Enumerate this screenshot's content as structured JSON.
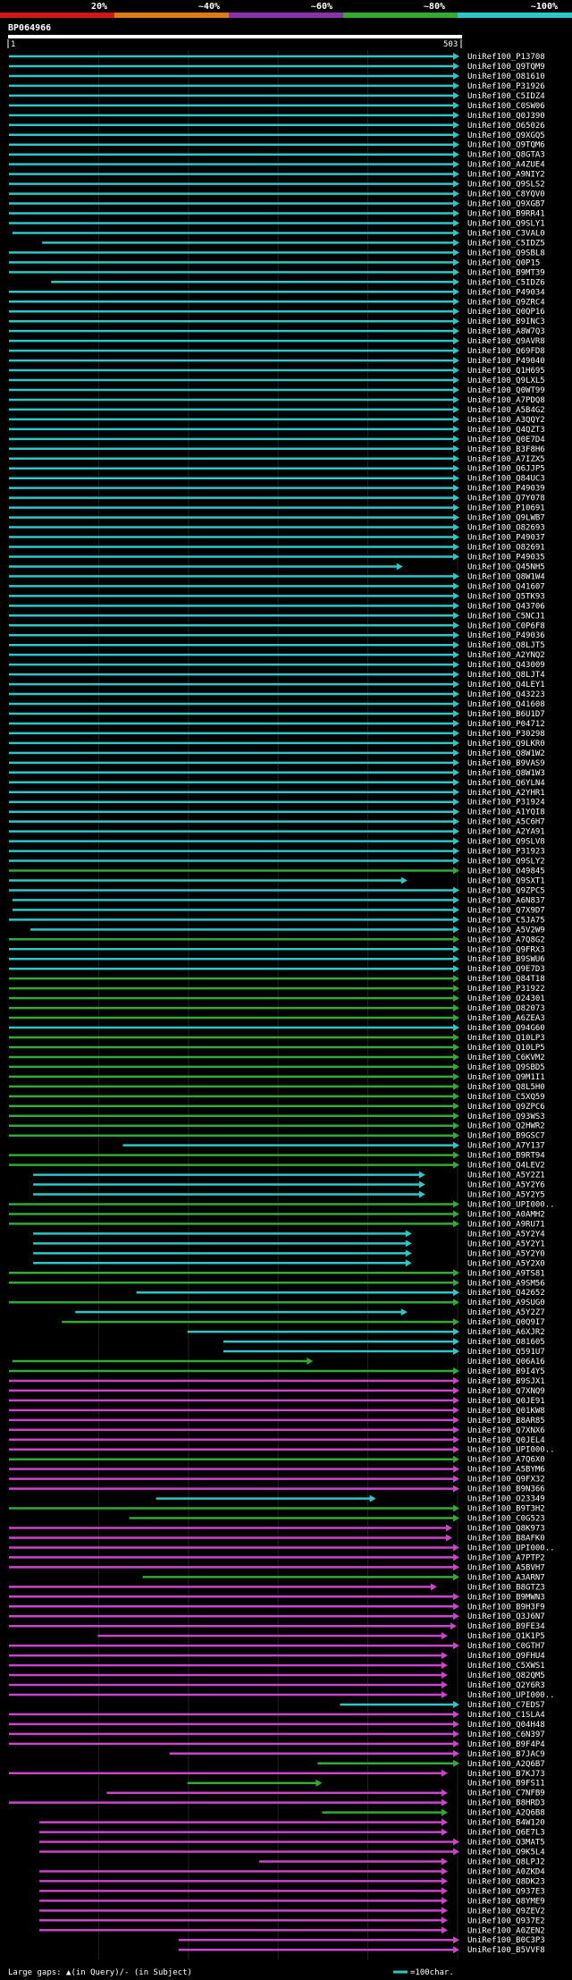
{
  "title": "BP064966",
  "colors": {
    "cyan": "#2cc8c8",
    "green": "#33aa33",
    "magenta": "#cc44cc",
    "purple": "#8833aa",
    "orange": "#e07a10",
    "red": "#d01818",
    "ruler": "#ffffff",
    "marker": "#e8e890"
  },
  "identity_scale": [
    {
      "label": "20%",
      "color": "#d01818"
    },
    {
      "label": "~40%",
      "color": "#e07a10"
    },
    {
      "label": "~60%",
      "color": "#8833aa"
    },
    {
      "label": "~80%",
      "color": "#33aa33"
    },
    {
      "label": "~100%",
      "color": "#2cc8c8"
    }
  ],
  "ruler": {
    "start_label": "1",
    "end_label": "503"
  },
  "legend": {
    "large_gaps_text": "Large gaps: ▲(in Query)/- (in Subject)",
    "scale_text": "=100char."
  },
  "chart_data": {
    "type": "alignment",
    "title": "BP064966",
    "query_length": 503,
    "xlim": [
      1,
      503
    ],
    "hits": [
      [
        "UniRef100_P13708",
        "c",
        1,
        503
      ],
      [
        "UniRef100_Q9TQM9",
        "c",
        1,
        503
      ],
      [
        "UniRef100_O81610",
        "c",
        1,
        503
      ],
      [
        "UniRef100_P31926",
        "c",
        1,
        503
      ],
      [
        "UniRef100_C5IDZ4",
        "c",
        1,
        503
      ],
      [
        "UniRef100_C0SW06",
        "c",
        1,
        503
      ],
      [
        "UniRef100_Q0J390",
        "c",
        1,
        503
      ],
      [
        "UniRef100_O65026",
        "c",
        1,
        503
      ],
      [
        "UniRef100_Q9XGQ5",
        "c",
        1,
        503
      ],
      [
        "UniRef100_Q9TQM6",
        "c",
        1,
        503
      ],
      [
        "UniRef100_Q8GTA3",
        "c",
        1,
        503
      ],
      [
        "UniRef100_A4ZUE4",
        "c",
        1,
        503
      ],
      [
        "UniRef100_A9NIY2",
        "c",
        1,
        503
      ],
      [
        "UniRef100_Q9SLS2",
        "c",
        1,
        503
      ],
      [
        "UniRef100_C8YQV0",
        "c",
        1,
        503
      ],
      [
        "UniRef100_Q9XGB7",
        "c",
        1,
        503
      ],
      [
        "UniRef100_B9RR41",
        "c",
        1,
        503
      ],
      [
        "UniRef100_Q9SLY1",
        "c",
        1,
        503
      ],
      [
        "UniRef100_C3VAL0",
        "c",
        5,
        503
      ],
      [
        "UniRef100_C5IDZ5",
        "c",
        38,
        503
      ],
      [
        "UniRef100_Q9SBL8",
        "c",
        1,
        503
      ],
      [
        "UniRef100_Q0P15",
        "c",
        1,
        503
      ],
      [
        "UniRef100_B9MT39",
        "c",
        1,
        503
      ],
      [
        "UniRef100_C5IDZ6",
        "c",
        48,
        503
      ],
      [
        "UniRef100_P49034",
        "c",
        1,
        503
      ],
      [
        "UniRef100_Q9ZRC4",
        "c",
        1,
        503
      ],
      [
        "UniRef100_Q0QP16",
        "c",
        1,
        503
      ],
      [
        "UniRef100_B9INC3",
        "c",
        1,
        503
      ],
      [
        "UniRef100_A8W7Q3",
        "c",
        1,
        503
      ],
      [
        "UniRef100_Q9AVR8",
        "c",
        1,
        503
      ],
      [
        "UniRef100_Q69FD8",
        "c",
        1,
        503
      ],
      [
        "UniRef100_P49040",
        "c",
        1,
        503
      ],
      [
        "UniRef100_Q1H695",
        "c",
        1,
        503
      ],
      [
        "UniRef100_Q9LXL5",
        "c",
        1,
        503
      ],
      [
        "UniRef100_Q0WT99",
        "c",
        1,
        503
      ],
      [
        "UniRef100_A7PDQ8",
        "c",
        1,
        503
      ],
      [
        "UniRef100_A5B4G2",
        "c",
        1,
        503
      ],
      [
        "UniRef100_A3QQY2",
        "c",
        1,
        503
      ],
      [
        "UniRef100_Q4QZT3",
        "c",
        1,
        503
      ],
      [
        "UniRef100_Q0E7D4",
        "c",
        1,
        503
      ],
      [
        "UniRef100_B3F8H6",
        "c",
        1,
        503
      ],
      [
        "UniRef100_A7IZX5",
        "c",
        1,
        503
      ],
      [
        "UniRef100_Q6JJP5",
        "c",
        1,
        503
      ],
      [
        "UniRef100_Q84UC3",
        "c",
        1,
        503
      ],
      [
        "UniRef100_P49039",
        "c",
        1,
        503
      ],
      [
        "UniRef100_Q7Y078",
        "c",
        1,
        503
      ],
      [
        "UniRef100_P10691",
        "c",
        1,
        503
      ],
      [
        "UniRef100_Q9LWB7",
        "c",
        1,
        503
      ],
      [
        "UniRef100_O82693",
        "c",
        1,
        503
      ],
      [
        "UniRef100_P49037",
        "c",
        1,
        503
      ],
      [
        "UniRef100_O82691",
        "c",
        1,
        503
      ],
      [
        "UniRef100_P49035",
        "c",
        1,
        503
      ],
      [
        "UniRef100_Q45NH5",
        "c",
        1,
        440
      ],
      [
        "UniRef100_Q8W1W4",
        "c",
        1,
        503
      ],
      [
        "UniRef100_Q41607",
        "c",
        1,
        503
      ],
      [
        "UniRef100_Q5TK93",
        "c",
        1,
        503
      ],
      [
        "UniRef100_Q43706",
        "c",
        1,
        503
      ],
      [
        "UniRef100_C5NCJ1",
        "c",
        1,
        503
      ],
      [
        "UniRef100_C0P6F8",
        "c",
        1,
        503
      ],
      [
        "UniRef100_P49036",
        "c",
        1,
        503
      ],
      [
        "UniRef100_Q8LJT5",
        "c",
        1,
        503
      ],
      [
        "UniRef100_A2YNQ2",
        "c",
        1,
        503
      ],
      [
        "UniRef100_Q43009",
        "c",
        1,
        503
      ],
      [
        "UniRef100_Q8LJT4",
        "c",
        1,
        503
      ],
      [
        "UniRef100_Q4LEY1",
        "c",
        1,
        503
      ],
      [
        "UniRef100_Q43223",
        "c",
        1,
        503
      ],
      [
        "UniRef100_Q41608",
        "c",
        1,
        503
      ],
      [
        "UniRef100_B6U1D7",
        "c",
        1,
        503
      ],
      [
        "UniRef100_P04712",
        "c",
        1,
        503
      ],
      [
        "UniRef100_P30298",
        "c",
        1,
        503
      ],
      [
        "UniRef100_Q9LKR0",
        "c",
        1,
        503
      ],
      [
        "UniRef100_Q8W1W2",
        "c",
        1,
        503
      ],
      [
        "UniRef100_B9VAS9",
        "c",
        1,
        503
      ],
      [
        "UniRef100_Q8W1W3",
        "c",
        1,
        503
      ],
      [
        "UniRef100_Q6YLN4",
        "c",
        1,
        503
      ],
      [
        "UniRef100_A2YHR1",
        "c",
        1,
        503
      ],
      [
        "UniRef100_P31924",
        "c",
        1,
        503
      ],
      [
        "UniRef100_A1YQI8",
        "c",
        1,
        503
      ],
      [
        "UniRef100_A5C6H7",
        "c",
        1,
        503
      ],
      [
        "UniRef100_A2YA91",
        "c",
        1,
        503
      ],
      [
        "UniRef100_Q9SLV8",
        "c",
        1,
        503
      ],
      [
        "UniRef100_P31923",
        "c",
        1,
        503
      ],
      [
        "UniRef100_Q9SLY2",
        "c",
        1,
        503
      ],
      [
        "UniRef100_O49845",
        "g",
        1,
        503
      ],
      [
        "UniRef100_Q9SXT1",
        "c",
        1,
        445
      ],
      [
        "UniRef100_Q9ZPC5",
        "c",
        1,
        503
      ],
      [
        "UniRef100_A6N837",
        "c",
        5,
        503
      ],
      [
        "UniRef100_Q7X9D7",
        "c",
        5,
        503
      ],
      [
        "UniRef100_C5JA75",
        "c",
        1,
        503
      ],
      [
        "UniRef100_A5V2W9",
        "c",
        25,
        503
      ],
      [
        "UniRef100_A7Q8G2",
        "g",
        1,
        503
      ],
      [
        "UniRef100_Q9FRX3",
        "c",
        1,
        503
      ],
      [
        "UniRef100_B9SWU6",
        "c",
        1,
        503
      ],
      [
        "UniRef100_Q9E7D3",
        "c",
        1,
        503
      ],
      [
        "UniRef100_Q84T18",
        "g",
        1,
        503
      ],
      [
        "UniRef100_P31922",
        "g",
        1,
        503
      ],
      [
        "UniRef100_O24301",
        "g",
        1,
        503
      ],
      [
        "UniRef100_O82073",
        "g",
        1,
        503
      ],
      [
        "UniRef100_A6ZEA3",
        "g",
        1,
        503
      ],
      [
        "UniRef100_Q94G60",
        "c",
        1,
        503
      ],
      [
        "UniRef100_Q10LP3",
        "g",
        1,
        503
      ],
      [
        "UniRef100_Q10LP5",
        "g",
        1,
        503
      ],
      [
        "UniRef100_C6KVM2",
        "g",
        1,
        503
      ],
      [
        "UniRef100_Q9SBD5",
        "g",
        1,
        503
      ],
      [
        "UniRef100_Q9M1I1",
        "g",
        1,
        503
      ],
      [
        "UniRef100_Q8L5H0",
        "g",
        1,
        503
      ],
      [
        "UniRef100_C5XQ59",
        "g",
        1,
        503
      ],
      [
        "UniRef100_Q9ZPC6",
        "g",
        1,
        503
      ],
      [
        "UniRef100_Q93WS3",
        "g",
        1,
        503
      ],
      [
        "UniRef100_Q2HWR2",
        "g",
        1,
        503
      ],
      [
        "UniRef100_B9GSC7",
        "g",
        1,
        503
      ],
      [
        "UniRef100_A7Y137",
        "c",
        128,
        503
      ],
      [
        "UniRef100_B9RT94",
        "g",
        1,
        503
      ],
      [
        "UniRef100_Q4LEV2",
        "g",
        1,
        503
      ],
      [
        "UniRef100_A5Y2Z1",
        "c",
        28,
        465
      ],
      [
        "UniRef100_A5Y2Y6",
        "c",
        28,
        465
      ],
      [
        "UniRef100_A5Y2Y5",
        "c",
        28,
        465
      ],
      [
        "UniRef100_UPI000..",
        "g",
        1,
        503
      ],
      [
        "UniRef100_A0AMH2",
        "g",
        1,
        503
      ],
      [
        "UniRef100_A9RU71",
        "g",
        1,
        503
      ],
      [
        "UniRef100_A5Y2Y4",
        "c",
        28,
        450
      ],
      [
        "UniRef100_A5Y2Y1",
        "c",
        28,
        450
      ],
      [
        "UniRef100_A5Y2Y0",
        "c",
        28,
        450
      ],
      [
        "UniRef100_A5Y2X0",
        "c",
        28,
        450
      ],
      [
        "UniRef100_A9TS81",
        "g",
        1,
        503
      ],
      [
        "UniRef100_A9SM56",
        "g",
        1,
        503
      ],
      [
        "UniRef100_Q42652",
        "c",
        143,
        503
      ],
      [
        "UniRef100_A9SUG0",
        "g",
        1,
        503
      ],
      [
        "UniRef100_A5Y2Z7",
        "c",
        75,
        445
      ],
      [
        "UniRef100_Q0Q9I7",
        "g",
        60,
        503
      ],
      [
        "UniRef100_A6XJR2",
        "c",
        200,
        503
      ],
      [
        "UniRef100_O81605",
        "c",
        240,
        503
      ],
      [
        "UniRef100_Q591U7",
        "c",
        240,
        503
      ],
      [
        "UniRef100_Q06A16",
        "g",
        5,
        340
      ],
      [
        "UniRef100_B9I4Y5",
        "g",
        1,
        503
      ],
      [
        "UniRef100_B9SJX1",
        "m",
        1,
        503
      ],
      [
        "UniRef100_Q7XNQ9",
        "m",
        1,
        503
      ],
      [
        "UniRef100_Q0JE91",
        "m",
        1,
        503
      ],
      [
        "UniRef100_Q01KW8",
        "m",
        1,
        503
      ],
      [
        "UniRef100_B8AR85",
        "m",
        1,
        503
      ],
      [
        "UniRef100_Q7XNX6",
        "m",
        1,
        503
      ],
      [
        "UniRef100_Q0JEL4",
        "m",
        1,
        503
      ],
      [
        "UniRef100_UPI000..",
        "m",
        1,
        503
      ],
      [
        "UniRef100_A7Q6X0",
        "g",
        1,
        503
      ],
      [
        "UniRef100_A5BYM6",
        "m",
        1,
        503
      ],
      [
        "UniRef100_Q9FX32",
        "m",
        1,
        503
      ],
      [
        "UniRef100_B9N366",
        "m",
        1,
        503
      ],
      [
        "UniRef100_O23349",
        "c",
        165,
        410
      ],
      [
        "UniRef100_B9T3H2",
        "g",
        1,
        503
      ],
      [
        "UniRef100_C0G523",
        "g",
        135,
        503
      ],
      [
        "UniRef100_Q8K973",
        "m",
        1,
        495
      ],
      [
        "UniRef100_B8AFK0",
        "m",
        1,
        495
      ],
      [
        "UniRef100_UPI000..",
        "m",
        1,
        503
      ],
      [
        "UniRef100_A7PTP2",
        "m",
        1,
        503
      ],
      [
        "UniRef100_A5BVH7",
        "m",
        1,
        503
      ],
      [
        "UniRef100_A3ARN7",
        "g",
        150,
        503
      ],
      [
        "UniRef100_B8GTZ3",
        "m",
        1,
        478
      ],
      [
        "UniRef100_B9MWN3",
        "m",
        1,
        503
      ],
      [
        "UniRef100_B9H3F9",
        "m",
        1,
        503
      ],
      [
        "UniRef100_Q3J6N7",
        "m",
        1,
        503
      ],
      [
        "UniRef100_B9FE34",
        "m",
        1,
        500
      ],
      [
        "UniRef100_Q1K1P5",
        "m",
        100,
        490
      ],
      [
        "UniRef100_C0GTH7",
        "m",
        1,
        503
      ],
      [
        "UniRef100_Q9FHU4",
        "m",
        1,
        490
      ],
      [
        "UniRef100_C5XWS1",
        "m",
        1,
        490
      ],
      [
        "UniRef100_Q82QM5",
        "m",
        1,
        490
      ],
      [
        "UniRef100_Q2Y6R3",
        "m",
        1,
        490
      ],
      [
        "UniRef100_UPI000..",
        "m",
        1,
        490
      ],
      [
        "UniRef100_C7EDS7",
        "c",
        370,
        503
      ],
      [
        "UniRef100_C1SLA4",
        "m",
        1,
        503
      ],
      [
        "UniRef100_Q04H48",
        "m",
        1,
        503
      ],
      [
        "UniRef100_C6N397",
        "m",
        1,
        503
      ],
      [
        "UniRef100_B9F4P4",
        "m",
        1,
        503
      ],
      [
        "UniRef100_B7JAC9",
        "m",
        180,
        503
      ],
      [
        "UniRef100_A2Q6B7",
        "g",
        345,
        503
      ],
      [
        "UniRef100_B7KJ73",
        "m",
        1,
        490
      ],
      [
        "UniRef100_B9FS11",
        "g",
        200,
        350
      ],
      [
        "UniRef100_C7NFB9",
        "m",
        110,
        490
      ],
      [
        "UniRef100_B8HRD3",
        "m",
        1,
        490
      ],
      [
        "UniRef100_A2Q6B8",
        "g",
        350,
        490
      ],
      [
        "UniRef100_B4W120",
        "m",
        35,
        490
      ],
      [
        "UniRef100_Q6E7L3",
        "m",
        35,
        490
      ],
      [
        "UniRef100_Q3MAT5",
        "m",
        35,
        503
      ],
      [
        "UniRef100_Q9K5L4",
        "m",
        35,
        503
      ],
      [
        "UniRef100_Q8LPJ2",
        "m",
        280,
        490
      ],
      [
        "UniRef100_A0ZKD4",
        "m",
        35,
        490
      ],
      [
        "UniRef100_Q8DK23",
        "m",
        35,
        490
      ],
      [
        "UniRef100_Q937E3",
        "m",
        35,
        490
      ],
      [
        "UniRef100_Q8YME9",
        "m",
        35,
        490
      ],
      [
        "UniRef100_Q9ZEV2",
        "m",
        35,
        490
      ],
      [
        "UniRef100_Q937E2",
        "m",
        35,
        490
      ],
      [
        "UniRef100_A0ZEN2",
        "m",
        35,
        490
      ],
      [
        "UniRef100_B0C3P3",
        "m",
        190,
        503
      ],
      [
        "UniRef100_B5VVF8",
        "m",
        190,
        503
      ]
    ]
  }
}
